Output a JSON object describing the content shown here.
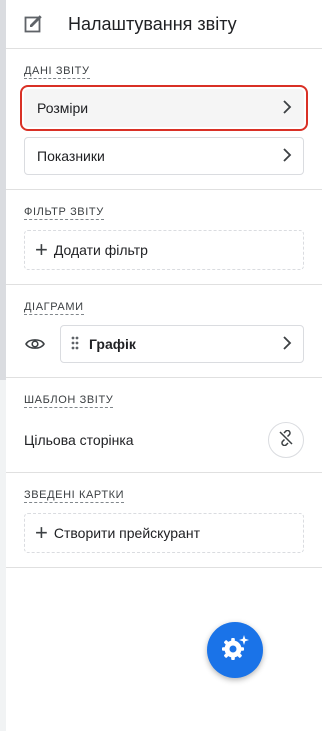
{
  "header": {
    "title": "Налаштування звіту",
    "icon": "edit-report-icon"
  },
  "report_data": {
    "label": "Дані звіту",
    "dimensions_label": "Розміри",
    "metrics_label": "Показники"
  },
  "report_filter": {
    "label": "Фільтр звіту",
    "add_filter_label": "Додати фільтр"
  },
  "charts": {
    "label": "Діаграми",
    "chart_label": "Графік"
  },
  "report_template": {
    "label": "Шаблон звіту",
    "template_name": "Цільова сторінка"
  },
  "summary_cards": {
    "label": "Зведені картки",
    "create_label": "Створити прейскурант"
  },
  "colors": {
    "accent": "#1a73e8",
    "highlight": "#d93025"
  }
}
